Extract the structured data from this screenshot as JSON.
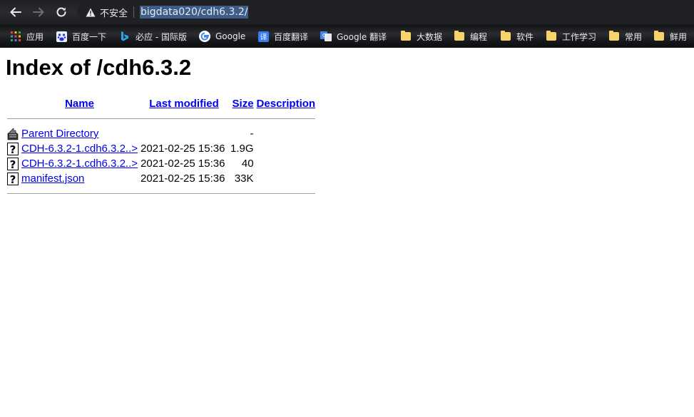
{
  "browser": {
    "security_label": "不安全",
    "url": "bigdata020/cdh6.3.2/"
  },
  "bookmarks": [
    {
      "label": "应用",
      "icon": "apps-grid-icon"
    },
    {
      "label": "百度一下",
      "icon": "baidu-icon"
    },
    {
      "label": "必应 - 国际版",
      "icon": "bing-icon"
    },
    {
      "label": "Google",
      "icon": "google-icon"
    },
    {
      "label": "百度翻译",
      "icon": "baidu-translate-icon"
    },
    {
      "label": "Google 翻译",
      "icon": "google-translate-icon"
    },
    {
      "label": "大数据",
      "icon": "folder-icon"
    },
    {
      "label": "编程",
      "icon": "folder-icon"
    },
    {
      "label": "软件",
      "icon": "folder-icon"
    },
    {
      "label": "工作学习",
      "icon": "folder-icon"
    },
    {
      "label": "常用",
      "icon": "folder-icon"
    },
    {
      "label": "鲜用",
      "icon": "folder-icon"
    }
  ],
  "page": {
    "title": "Index of /cdh6.3.2",
    "headers": {
      "name": "Name",
      "modified": "Last modified",
      "size": "Size",
      "description": "Description"
    },
    "rows": [
      {
        "icon": "back-icon",
        "name": "Parent Directory",
        "modified": "",
        "size": "-",
        "description": ""
      },
      {
        "icon": "unknown-file-icon",
        "name": "CDH-6.3.2-1.cdh6.3.2..>",
        "modified": "2021-02-25 15:36",
        "size": "1.9G",
        "description": ""
      },
      {
        "icon": "unknown-file-icon",
        "name": "CDH-6.3.2-1.cdh6.3.2..>",
        "modified": "2021-02-25 15:36",
        "size": "40",
        "description": ""
      },
      {
        "icon": "unknown-file-icon",
        "name": "manifest.json",
        "modified": "2021-02-25 15:36",
        "size": "33K",
        "description": ""
      }
    ]
  }
}
